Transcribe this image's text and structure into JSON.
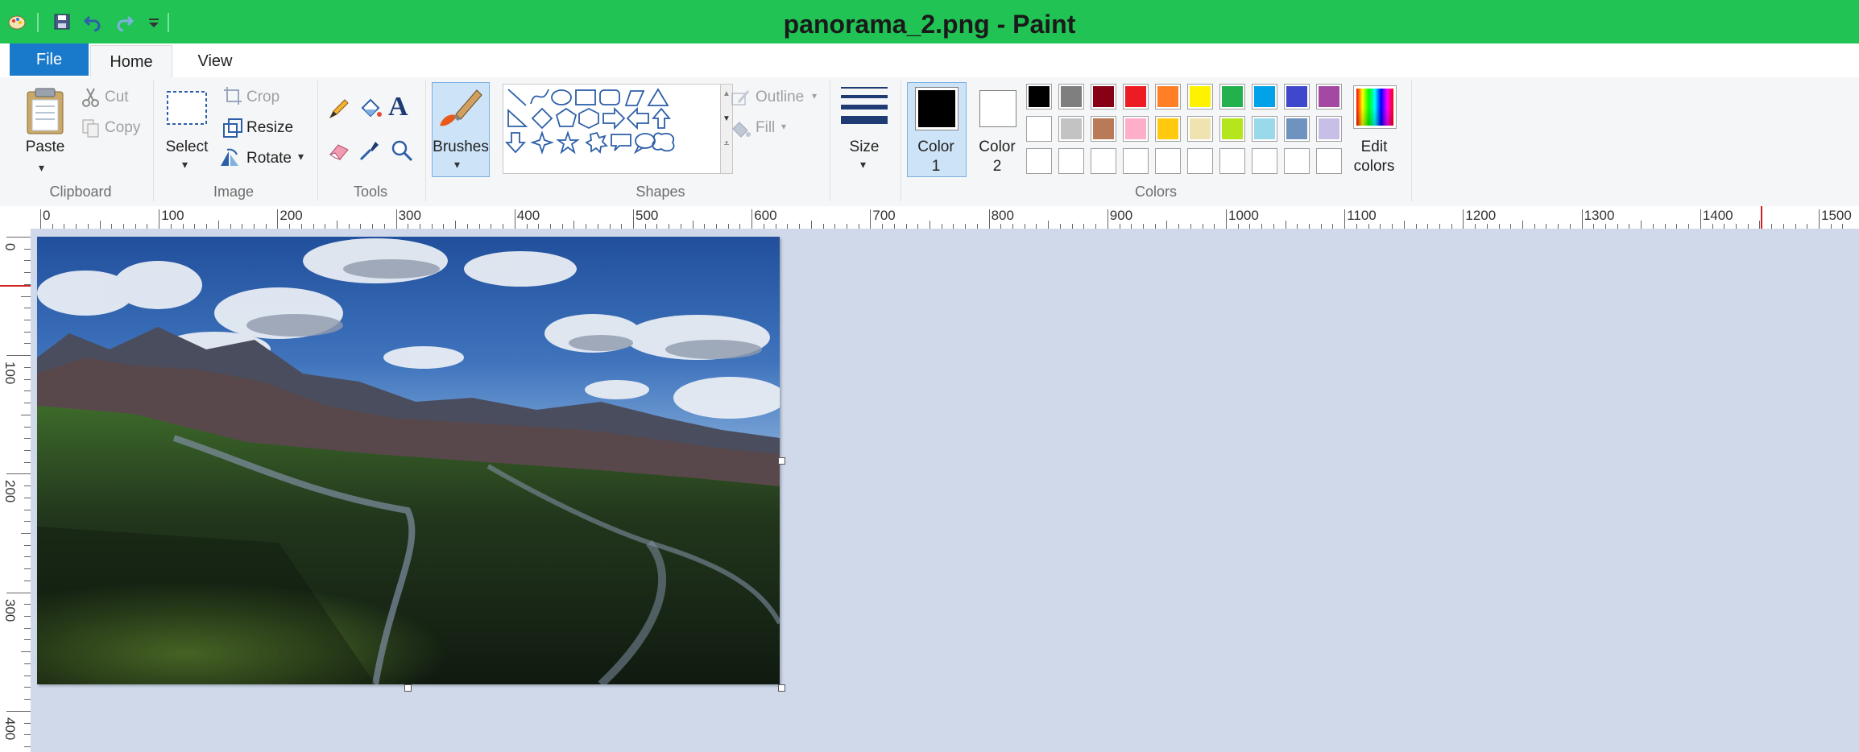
{
  "window": {
    "title": "panorama_2.png - Paint"
  },
  "tabs": {
    "file": "File",
    "home": "Home",
    "view": "View"
  },
  "clipboard": {
    "paste": "Paste",
    "cut": "Cut",
    "copy": "Copy",
    "group": "Clipboard"
  },
  "image": {
    "select": "Select",
    "crop": "Crop",
    "resize": "Resize",
    "rotate": "Rotate",
    "group": "Image"
  },
  "tools": {
    "group": "Tools"
  },
  "brushes": {
    "label": "Brushes"
  },
  "shapes": {
    "outline": "Outline",
    "fill": "Fill",
    "group": "Shapes"
  },
  "size": {
    "label": "Size"
  },
  "colors": {
    "color1_line1": "Color",
    "color1_line2": "1",
    "color2_line1": "Color",
    "color2_line2": "2",
    "edit_line1": "Edit",
    "edit_line2": "colors",
    "group": "Colors",
    "color1_value": "#000000",
    "color2_value": "#ffffff",
    "palette_row1": [
      "#000000",
      "#7f7f7f",
      "#880015",
      "#ed1c24",
      "#ff7f27",
      "#fff200",
      "#22b14c",
      "#00a2e8",
      "#3f48cc",
      "#a349a4"
    ],
    "palette_row2": [
      "#ffffff",
      "#c3c3c3",
      "#b97a57",
      "#ffaec9",
      "#ffc90e",
      "#efe4b0",
      "#b5e61d",
      "#99d9ea",
      "#7092be",
      "#c8bfe7"
    ]
  },
  "ruler": {
    "top": [
      "0",
      "100",
      "200",
      "300",
      "400",
      "500",
      "600",
      "700",
      "800",
      "900",
      "1000",
      "1100",
      "1200",
      "1300",
      "1400",
      "1500"
    ],
    "left": [
      "0",
      "100",
      "200",
      "300",
      "400"
    ]
  },
  "theme": {
    "titlebar": "#21c354",
    "file_tab": "#1979ca",
    "workspace": "#cfd9ea"
  }
}
